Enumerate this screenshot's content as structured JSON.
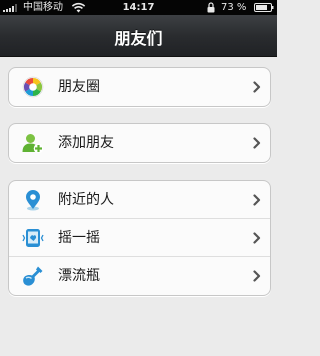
{
  "status_bar": {
    "carrier": "中国移动",
    "time": "14:17",
    "battery_percent": "73 %"
  },
  "nav": {
    "title": "朋友们"
  },
  "groups": [
    {
      "items": [
        {
          "label": "朋友圈",
          "icon": "moments-icon"
        }
      ]
    },
    {
      "items": [
        {
          "label": "添加朋友",
          "icon": "add-friend-icon"
        }
      ]
    },
    {
      "items": [
        {
          "label": "附近的人",
          "icon": "location-pin-icon"
        },
        {
          "label": "摇一摇",
          "icon": "shake-icon"
        },
        {
          "label": "漂流瓶",
          "icon": "drift-bottle-icon"
        }
      ]
    }
  ]
}
